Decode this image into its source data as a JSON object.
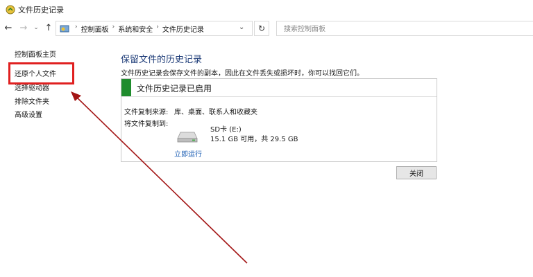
{
  "window": {
    "title": "文件历史记录"
  },
  "nav": {
    "back_icon": "arrow-left-icon",
    "forward_icon": "arrow-right-icon",
    "recent_icon": "chevron-down-icon",
    "up_icon": "arrow-up-icon",
    "breadcrumbs": [
      "控制面板",
      "系统和安全",
      "文件历史记录"
    ],
    "search_placeholder": "搜索控制面板"
  },
  "sidebar": {
    "items": [
      {
        "label": "控制面板主页"
      },
      {
        "label": "还原个人文件"
      },
      {
        "label": "选择驱动器"
      },
      {
        "label": "排除文件夹"
      },
      {
        "label": "高级设置"
      }
    ]
  },
  "main": {
    "title": "保留文件的历史记录",
    "description": "文件历史记录会保存文件的副本，因此在文件丢失或损坏时，你可以找回它们。",
    "status": "文件历史记录已启用",
    "copy_from_label": "文件复制来源:",
    "copy_from_value": "库、桌面、联系人和收藏夹",
    "copy_to_label": "将文件复制到:",
    "drive_name": "SD卡 (E:)",
    "drive_space": "15.1 GB 可用，共 29.5 GB",
    "run_now": "立即运行",
    "close_button": "关闭"
  },
  "colors": {
    "status_green": "#1f8c2d",
    "highlight_red": "#e02020",
    "arrow_red": "#a31515",
    "title_blue": "#1e3c78",
    "link_blue": "#1e5fb4"
  }
}
